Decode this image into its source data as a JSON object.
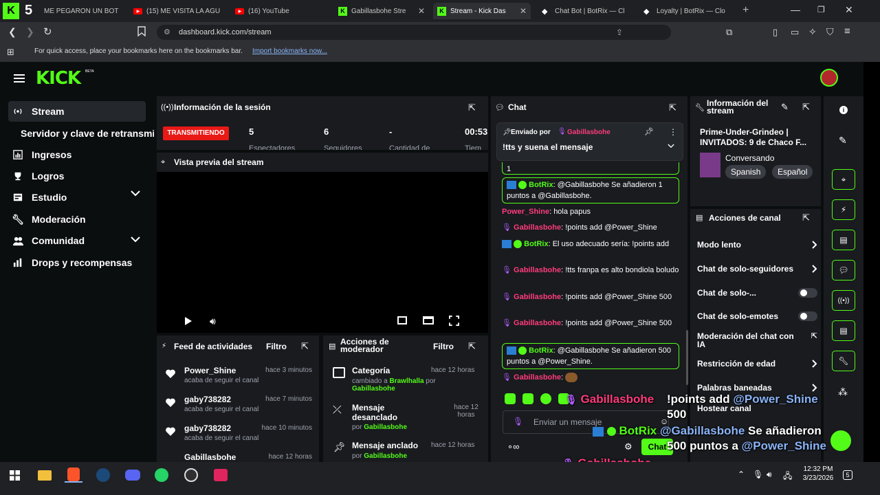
{
  "browser": {
    "tabs": [
      {
        "label": "ME PEGARON UN BOT"
      },
      {
        "label": "(15) ME VISITA LA AGU"
      },
      {
        "label": "(16) YouTube"
      },
      {
        "label": "Gabillasbohe Stre"
      },
      {
        "label": "Stream - Kick Das"
      },
      {
        "label": "Chat Bot | BotRix — Cl"
      },
      {
        "label": "Loyalty | BotRix — Clo"
      }
    ],
    "url": "dashboard.kick.com/stream",
    "bookmarks_text": "For quick access, place your bookmarks here on the bookmarks bar.",
    "bookmarks_link": "Import bookmarks now...",
    "colors": {
      "brand": "#53fc18",
      "live": "#e91916",
      "username": "#ff3b7b"
    }
  },
  "kick": {
    "logo": "KICK",
    "beta": "BETA",
    "nav": [
      {
        "label": "Stream",
        "icon": "broadcast-icon"
      },
      {
        "label": "Servidor y clave de retransmisión",
        "icon": ""
      },
      {
        "label": "Ingresos",
        "icon": "chart-icon"
      },
      {
        "label": "Logros",
        "icon": "trophy-icon"
      },
      {
        "label": "Estudio",
        "icon": "studio-icon"
      },
      {
        "label": "Moderación",
        "icon": "wrench-icon"
      },
      {
        "label": "Comunidad",
        "icon": "people-icon"
      },
      {
        "label": "Drops y recompensas",
        "icon": "gift-icon"
      }
    ]
  },
  "session": {
    "title": "Información de la sesión",
    "status": "TRANSMITIENDO",
    "stats": [
      {
        "value": "5",
        "label": "Espectadores"
      },
      {
        "value": "6",
        "label": "Seguidores"
      },
      {
        "value": "-",
        "label": "Cantidad de"
      },
      {
        "value": "00:53",
        "label": "Tiem"
      }
    ]
  },
  "preview": {
    "title": "Vista previa del stream"
  },
  "feed": {
    "title": "Feed de actividades",
    "filter": "Filtro",
    "items": [
      {
        "name": "Power_Shine",
        "time": "hace 3 minutos",
        "desc": "acaba de seguir el canal"
      },
      {
        "name": "gaby738282",
        "time": "hace 7 minutos",
        "desc": "acaba de seguir el canal"
      },
      {
        "name": "gaby738282",
        "time": "hace 10 minutos",
        "desc": "acaba de seguir el canal"
      },
      {
        "name": "Gabillasbohe",
        "time": "hace 12 horas",
        "desc": ""
      }
    ]
  },
  "modactions": {
    "title_line1": "Acciones de",
    "title_line2": "moderador",
    "filter": "Filtro",
    "items": [
      {
        "title": "Categoría",
        "time": "hace 12 horas",
        "desc1": "cambiado a",
        "highlight": "Brawlhalla",
        "desc2": "por",
        "by": "Gabillasbohe"
      },
      {
        "title": "Mensaje desanclado",
        "time": "hace 12 horas",
        "desc1": "por",
        "by": "Gabillasbohe"
      },
      {
        "title": "Mensaje anclado",
        "time": "hace 12 horas",
        "desc1": "por",
        "by": "Gabillasbohe"
      }
    ]
  },
  "chat": {
    "title": "Chat",
    "pinned_by": "Enviado por",
    "pinned_user": "Gabillasbohe",
    "pinned_msg": "!tts y suena el mensaje",
    "frag": "1",
    "messages": [
      {
        "user": "BotRix",
        "text": ": @Gabillasbohe Se añadieron 1 puntos a @Gabillasbohe."
      },
      {
        "user": "Power_Shine",
        "text": ": hola papus"
      },
      {
        "user": "Gabillasbohe",
        "text": ": !points add @Power_Shine"
      },
      {
        "user": "BotRix",
        "text": ": El uso adecuado sería: !points add"
      },
      {
        "user": "Gabillasbohe",
        "text": ": !tts franpa es alto bondiola boludo"
      },
      {
        "user": "Gabillasbohe",
        "text": ": !points add @Power_Shine 500"
      },
      {
        "user": "Gabillasbohe",
        "text": ": !points add @Power_Shine 500"
      },
      {
        "user": "BotRix",
        "text": ": @Gabillasbohe Se añadieron 500 puntos a @Power_Shine."
      },
      {
        "user": "Gabillasbohe",
        "text": ":"
      }
    ],
    "placeholder": "Enviar un mensaje",
    "send": "Chat"
  },
  "streaminfo": {
    "title_line1": "Información del",
    "title_line2": "stream",
    "stream_title": "Prime-Under-Grindeo | INVITADOS: 9 de Chaco F...",
    "category": "Conversando",
    "tags": [
      "Spanish",
      "Español"
    ]
  },
  "channelactions": {
    "title": "Acciones de canal",
    "items": [
      {
        "label": "Modo lento",
        "control": "chevron"
      },
      {
        "label": "Chat de solo-seguidores",
        "control": "chevron"
      },
      {
        "label": "Chat de solo-...",
        "control": "toggle"
      },
      {
        "label": "Chat de solo-emotes",
        "control": "toggle"
      },
      {
        "label": "Moderación del chat con IA",
        "control": "external"
      },
      {
        "label": "Restricción de edad",
        "control": "chevron"
      },
      {
        "label": "Palabras baneadas",
        "control": "chevron"
      },
      {
        "label": "Hostear canal",
        "control": ""
      }
    ]
  },
  "overlay": {
    "user1": "Gabillasbohe",
    "msg1a": "!points add",
    "mention1": "@Power_Shine",
    "msg1b": "500",
    "bot": "BotRix",
    "mention2": "@Gabillasbohe",
    "msg2a": "Se añadieron",
    "msg2b": "500 puntos a",
    "mention3": "@Power_Shine",
    "user3": "Gabillasbohe"
  },
  "taskbar": {
    "time": "12:32 PM",
    "date": "3/23/2026",
    "badge": "5"
  }
}
